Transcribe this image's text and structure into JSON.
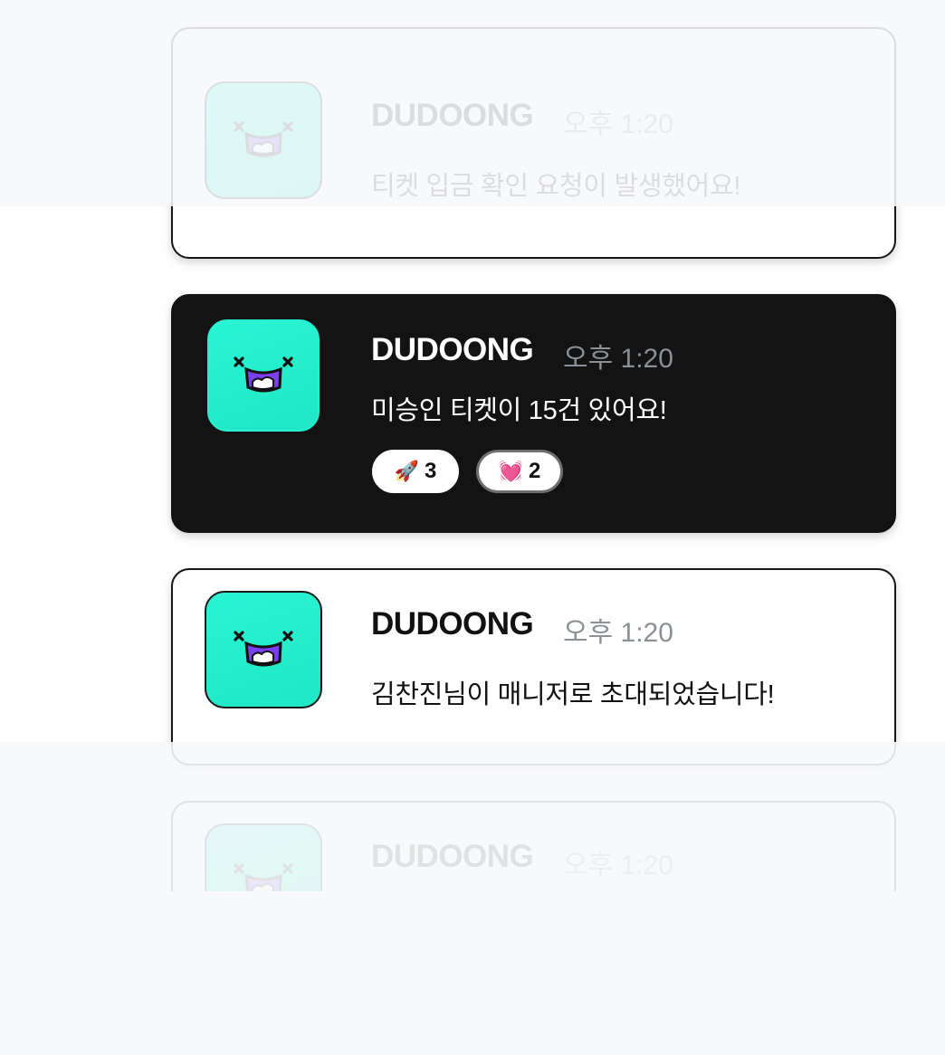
{
  "notifications": [
    {
      "sender": "DUDOONG",
      "time": "오후 1:20",
      "message": "티켓 입금 확인 요청이 발생했어요!"
    },
    {
      "sender": "DUDOONG",
      "time": "오후 1:20",
      "message": "미승인 티켓이 15건 있어요!",
      "reactions": [
        {
          "emoji": "🚀",
          "count": "3"
        },
        {
          "emoji": "💓",
          "count": "2"
        }
      ]
    },
    {
      "sender": "DUDOONG",
      "time": "오후 1:20",
      "message": "김찬진님이  매니저로 초대되었습니다!"
    },
    {
      "sender": "DUDOONG",
      "time": "오후 1:20"
    }
  ],
  "colors": {
    "accent": "#22F2CF",
    "mouth": "#7B3FF2",
    "dark_card": "#131313",
    "background": "#F7F8FA"
  },
  "icons": {
    "avatar": "dudoong-mascot-icon"
  }
}
